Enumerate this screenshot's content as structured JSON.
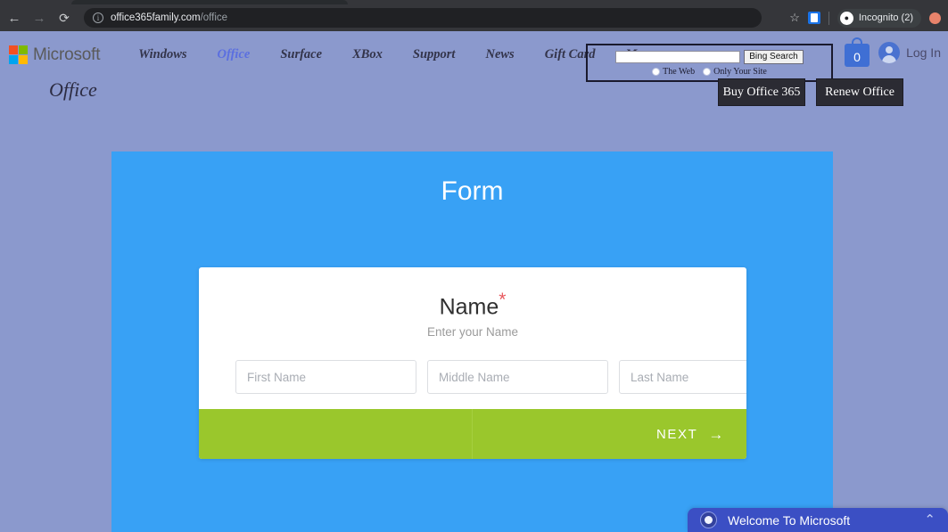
{
  "browser": {
    "back_icon": "back-arrow",
    "forward_icon": "forward-arrow",
    "reload_icon": "reload",
    "info_icon": "ⓘ",
    "url_domain": "office365family.com",
    "url_path": "/office",
    "star_icon": "☆",
    "extension_icon": "extension",
    "incognito_glyph": "🕵",
    "incognito_label": "Incognito (2)",
    "profile_avatar": "profile-avatar"
  },
  "site_header": {
    "brand": "Microsoft",
    "logo_colors": [
      "#f25022",
      "#7fba00",
      "#00a4ef",
      "#ffb900"
    ],
    "nav": [
      {
        "label": "Windows",
        "active": false
      },
      {
        "label": "Office",
        "active": true
      },
      {
        "label": "Surface",
        "active": false
      },
      {
        "label": "XBox",
        "active": false
      },
      {
        "label": "Support",
        "active": false
      },
      {
        "label": "News",
        "active": false
      },
      {
        "label": "Gift Card",
        "active": false
      },
      {
        "label": "More",
        "active": false
      }
    ],
    "search": {
      "input_value": "",
      "input_placeholder": "",
      "button_label": "Bing Search",
      "scope_options": [
        "The Web",
        "Only Your Site"
      ]
    },
    "cart": {
      "count": "0",
      "icon": "shopping-bag-icon"
    },
    "login": {
      "label": "Log In",
      "icon": "user-avatar-icon"
    }
  },
  "office_row": {
    "wordmark": "Office",
    "buy_button": "Buy Office 365",
    "renew_button": "Renew Office"
  },
  "form": {
    "title": "Form",
    "panel_color": "#38a1f5",
    "heading": "Name",
    "required_marker": "*",
    "subtitle": "Enter your Name",
    "fields": [
      {
        "name": "first-name",
        "placeholder": "First Name",
        "value": ""
      },
      {
        "name": "middle-name",
        "placeholder": "Middle Name",
        "value": ""
      },
      {
        "name": "last-name",
        "placeholder": "Last Name",
        "value": ""
      }
    ],
    "next_label": "NEXT",
    "next_arrow": "→",
    "footer_color": "#9ac72c"
  },
  "chat": {
    "title": "Welcome To Microsoft",
    "chevron": "⌃",
    "avatar_icon": "chat-avatar-icon",
    "color": "#3b4fc4"
  }
}
